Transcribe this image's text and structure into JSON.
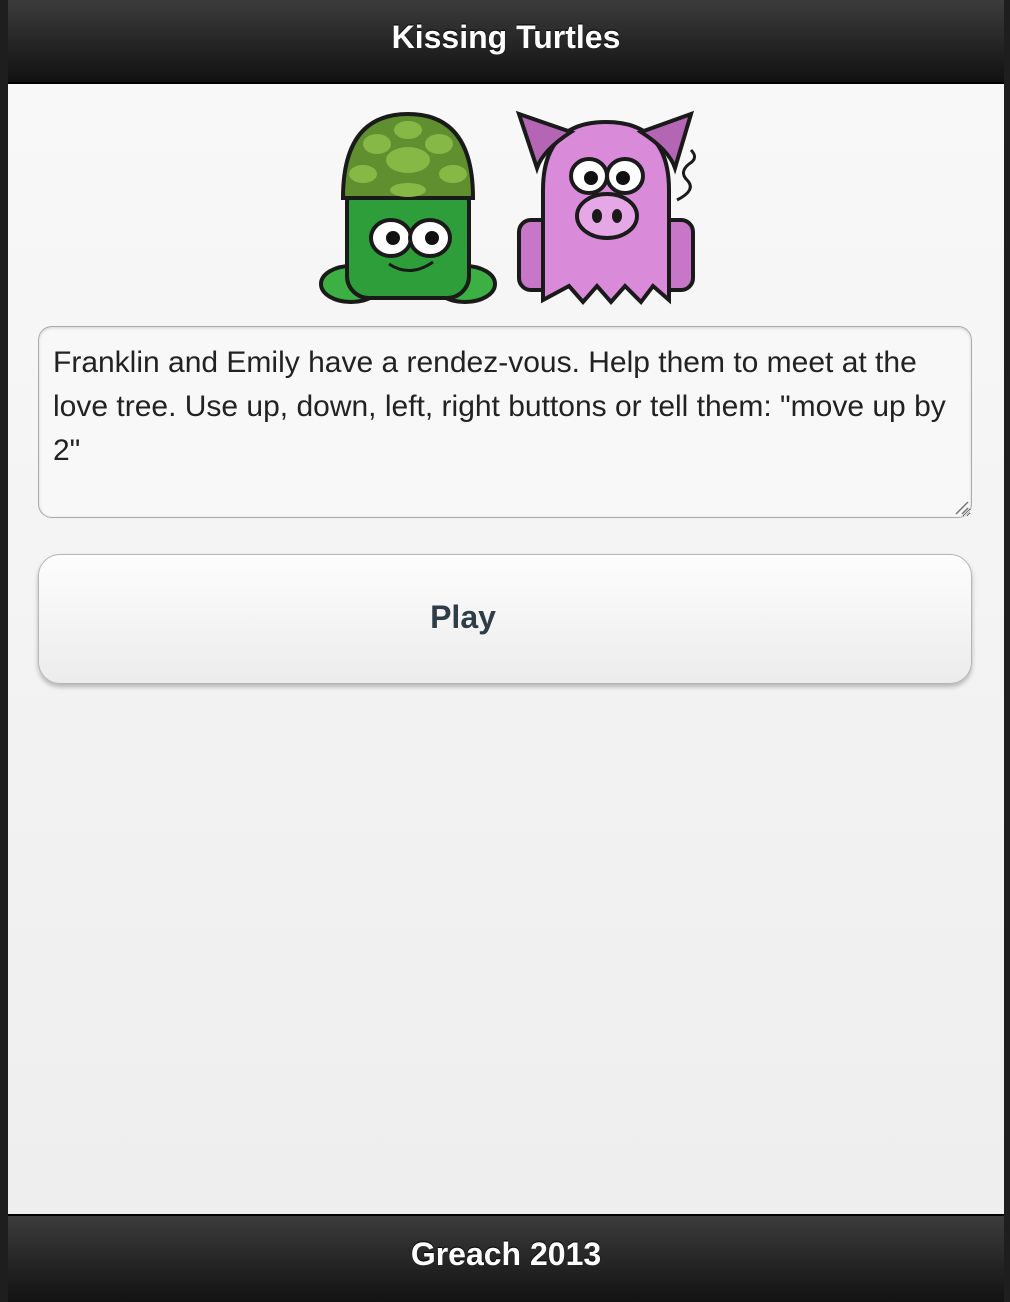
{
  "header": {
    "title": "Kissing Turtles"
  },
  "characters": {
    "left": {
      "name": "turtle",
      "icon": "turtle-icon"
    },
    "right": {
      "name": "pig",
      "icon": "pig-icon"
    }
  },
  "message": {
    "text": "Franklin and Emily have a rendez-vous. Help them to meet at the love tree. Use up, down, left, right buttons or tell them: \"move up by 2\""
  },
  "play_button": {
    "label": "Play"
  },
  "footer": {
    "title": "Greach 2013"
  },
  "colors": {
    "bar_dark": "#111111",
    "page_bg": "#f2f2f2",
    "button_text": "#2f3e46",
    "turtle_green": "#2e9e3a",
    "pig_pink": "#d27fd2"
  }
}
